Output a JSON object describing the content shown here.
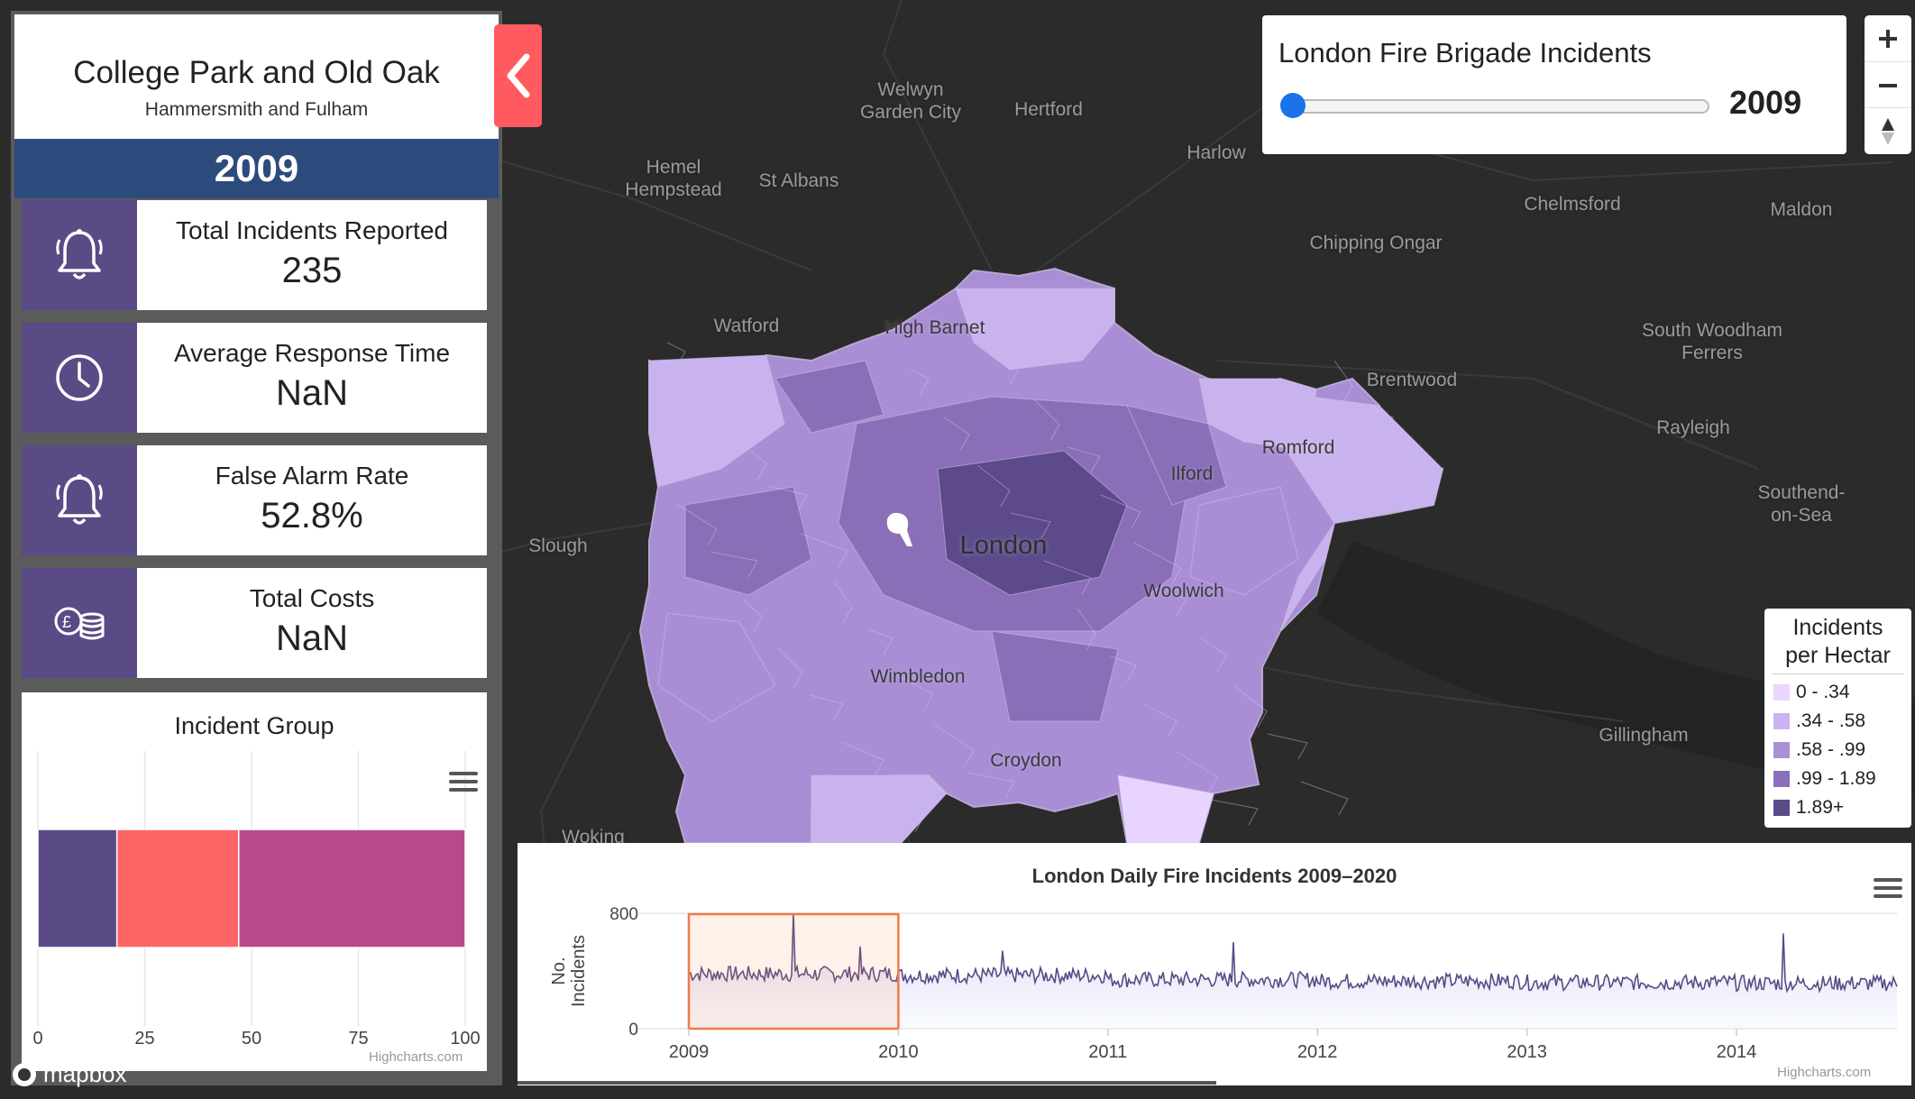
{
  "map": {
    "places": [
      {
        "id": "welwyn",
        "name": "Welwyn\nGarden City",
        "on": false
      },
      {
        "id": "hertford",
        "name": "Hertford",
        "on": false
      },
      {
        "id": "harlow",
        "name": "Harlow",
        "on": false
      },
      {
        "id": "hemel",
        "name": "Hemel\nHempstead",
        "on": false
      },
      {
        "id": "stalbans",
        "name": "St Albans",
        "on": false
      },
      {
        "id": "chelmsford",
        "name": "Chelmsford",
        "on": false
      },
      {
        "id": "maldon",
        "name": "Maldon",
        "on": false
      },
      {
        "id": "chipping",
        "name": "Chipping Ongar",
        "on": false
      },
      {
        "id": "watford",
        "name": "Watford",
        "on": false
      },
      {
        "id": "highbarnet",
        "name": "High Barnet",
        "on": true
      },
      {
        "id": "southwoodham",
        "name": "South Woodham\nFerrers",
        "on": false
      },
      {
        "id": "brentwood",
        "name": "Brentwood",
        "on": false
      },
      {
        "id": "romford",
        "name": "Romford",
        "on": true
      },
      {
        "id": "rayleigh",
        "name": "Rayleigh",
        "on": false
      },
      {
        "id": "ilford",
        "name": "Ilford",
        "on": true
      },
      {
        "id": "southend",
        "name": "Southend-\non-Sea",
        "on": false
      },
      {
        "id": "slough",
        "name": "Slough",
        "on": false
      },
      {
        "id": "london",
        "name": "London",
        "on": true
      },
      {
        "id": "woolwich",
        "name": "Woolwich",
        "on": true
      },
      {
        "id": "wimbledon",
        "name": "Wimbledon",
        "on": true
      },
      {
        "id": "gillingham",
        "name": "Gillingham",
        "on": false
      },
      {
        "id": "croydon",
        "name": "Croydon",
        "on": true
      },
      {
        "id": "woking",
        "name": "Woking",
        "on": false
      }
    ],
    "colors": {
      "c0": "#e8d5ff",
      "c1": "#c9b3ef",
      "c2": "#a98ed5",
      "c3": "#8a6fb8",
      "c4": "#5c4a8a"
    }
  },
  "sidebar": {
    "ward": "College Park and Old Oak",
    "borough": "Hammersmith and Fulham",
    "year": "2009",
    "cards": [
      {
        "label": "Total Incidents Reported",
        "value": "235",
        "icon": "bell-icon"
      },
      {
        "label": "Average Response Time",
        "value": "NaN",
        "icon": "clock-icon"
      },
      {
        "label": "False Alarm Rate",
        "value": "52.8%",
        "icon": "bell-icon"
      },
      {
        "label": "Total Costs",
        "value": "NaN",
        "icon": "coins-icon"
      }
    ],
    "incident_group": {
      "title": "Incident Group",
      "credit": "Highcharts.com"
    }
  },
  "slider": {
    "title": "London Fire Brigade Incidents",
    "year": "2009",
    "value_fraction": 0.0
  },
  "legend": {
    "title_line1": "Incidents",
    "title_line2": "per Hectar",
    "items": [
      {
        "label": "0 - .34",
        "color": "#ecd5ff"
      },
      {
        "label": ".34 - .58",
        "color": "#cdb2ef"
      },
      {
        "label": ".58 - .99",
        "color": "#ab90d6"
      },
      {
        "label": ".99 - 1.89",
        "color": "#8b6fbb"
      },
      {
        "label": "1.89+",
        "color": "#5c4a8a"
      }
    ]
  },
  "timeseries": {
    "title": "London Daily Fire Incidents 2009–2020",
    "ylabel_line1": "No.",
    "ylabel_line2": "Incidents",
    "credit": "Highcharts.com"
  },
  "mapbox_label": "mapbox",
  "chart_data": [
    {
      "type": "bar",
      "title": "Incident Group",
      "stacked": true,
      "categories": [
        ""
      ],
      "xlim": [
        0,
        100
      ],
      "ticks": [
        0,
        25,
        50,
        75,
        100
      ],
      "series": [
        {
          "values": [
            18.5
          ],
          "color": "#5a4a86"
        },
        {
          "values": [
            28.5
          ],
          "color": "#ff6464"
        },
        {
          "values": [
            53.0
          ],
          "color": "#b84a8c"
        }
      ]
    },
    {
      "type": "area",
      "title": "London Daily Fire Incidents 2009–2020",
      "ylabel": "No. Incidents",
      "ylim": [
        0,
        800
      ],
      "yticks": [
        0,
        800
      ],
      "x_ticks": [
        "2009",
        "2010",
        "2011",
        "2012",
        "2013",
        "2014"
      ],
      "series": [
        {
          "color": "#5a4a86",
          "yearly_baseline": [
            {
              "year": 2009,
              "value": 380
            },
            {
              "year": 2010,
              "value": 370
            },
            {
              "year": 2011,
              "value": 340
            },
            {
              "year": 2012,
              "value": 330
            },
            {
              "year": 2013,
              "value": 320
            },
            {
              "year": 2014,
              "value": 315
            }
          ],
          "peaks": [
            {
              "x": "2009-07",
              "value": 800
            },
            {
              "x": "2009-10",
              "value": 570
            },
            {
              "x": "2010-07",
              "value": 540
            },
            {
              "x": "2011-07",
              "value": 600
            },
            {
              "x": "2014-03",
              "value": 660
            }
          ]
        }
      ],
      "navigator_range": [
        "2009",
        "2010"
      ]
    }
  ]
}
